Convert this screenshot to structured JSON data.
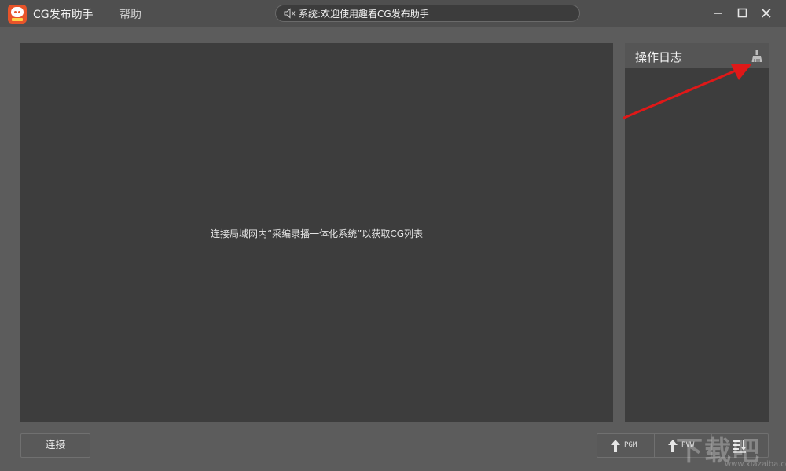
{
  "titlebar": {
    "app_title": "CG发布助手",
    "menu_help": "帮助",
    "notice": "系统:欢迎使用趣看CG发布助手"
  },
  "main": {
    "hint": "连接局域网内“采编录播一体化系统”以获取CG列表"
  },
  "log_panel": {
    "title": "操作日志",
    "clear_icon": "broom-icon"
  },
  "bottom": {
    "connect_label": "连接",
    "pgm_label": "PGM",
    "pvw_label": "PVW",
    "sort_icon": "sort-down-icon"
  },
  "watermark": {
    "text": "下载吧",
    "url": "www.xiazaiba.com"
  },
  "colors": {
    "background": "#5c5c5c",
    "titlebar": "#4f4f4f",
    "panel": "#3d3d3d",
    "logo": "#e8542a",
    "annotation_arrow": "#e01818"
  }
}
